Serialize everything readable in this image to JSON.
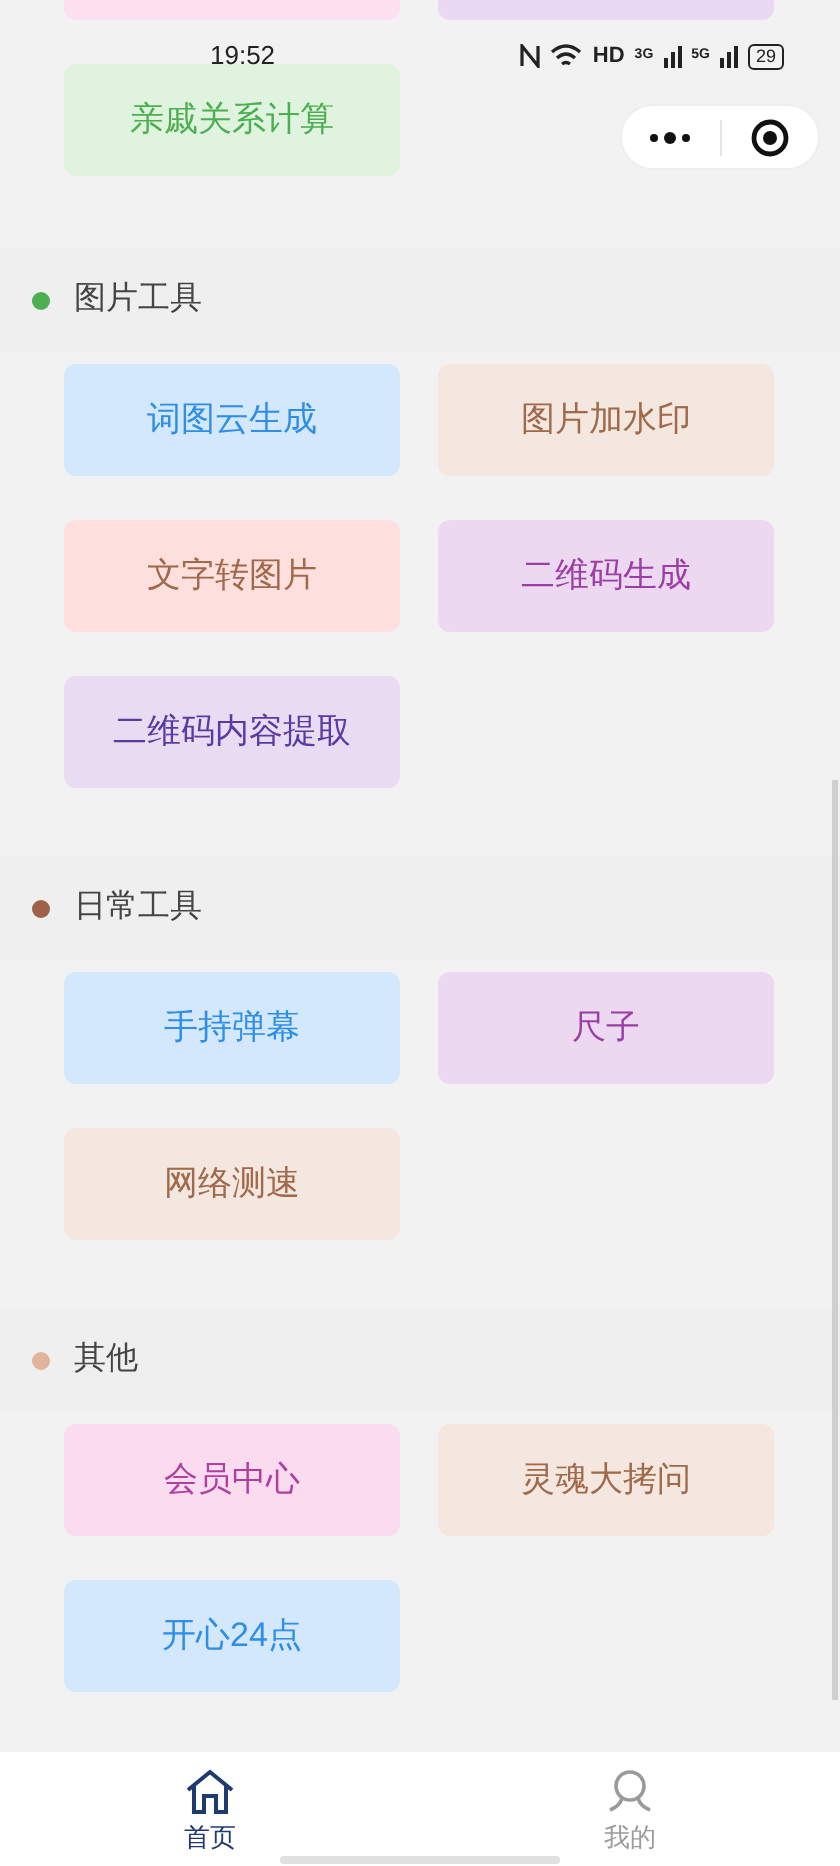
{
  "status_bar": {
    "time": "19:52",
    "network_label": "HD",
    "signal_1": "3G",
    "signal_2": "5G",
    "battery": "29"
  },
  "previous_section": {
    "items": [
      {
        "color": "#fde0ef"
      },
      {
        "color": "#ead9f3"
      }
    ]
  },
  "top_items": [
    {
      "label": "亲戚关系计算",
      "kind": "green"
    }
  ],
  "sections": [
    {
      "title": "图片工具",
      "color": "#4caf50",
      "items": [
        {
          "label": "词图云生成",
          "kind": "blue"
        },
        {
          "label": "图片加水印",
          "kind": "beige"
        },
        {
          "label": "文字转图片",
          "kind": "salmon"
        },
        {
          "label": "二维码生成",
          "kind": "purple"
        },
        {
          "label": "二维码内容提取",
          "kind": "violet"
        }
      ]
    },
    {
      "title": "日常工具",
      "color": "#a0614a",
      "items": [
        {
          "label": "手持弹幕",
          "kind": "blue"
        },
        {
          "label": "尺子",
          "kind": "purple"
        },
        {
          "label": "网络测速",
          "kind": "beige"
        }
      ]
    },
    {
      "title": "其他",
      "color": "#e0b49a",
      "items": [
        {
          "label": "会员中心",
          "kind": "pink"
        },
        {
          "label": "灵魂大拷问",
          "kind": "beige"
        },
        {
          "label": "开心24点",
          "kind": "blue"
        }
      ]
    }
  ],
  "tab_bar": [
    {
      "label": "首页",
      "selected": true,
      "kind": "home"
    },
    {
      "label": "我的",
      "selected": false,
      "kind": "user"
    }
  ]
}
